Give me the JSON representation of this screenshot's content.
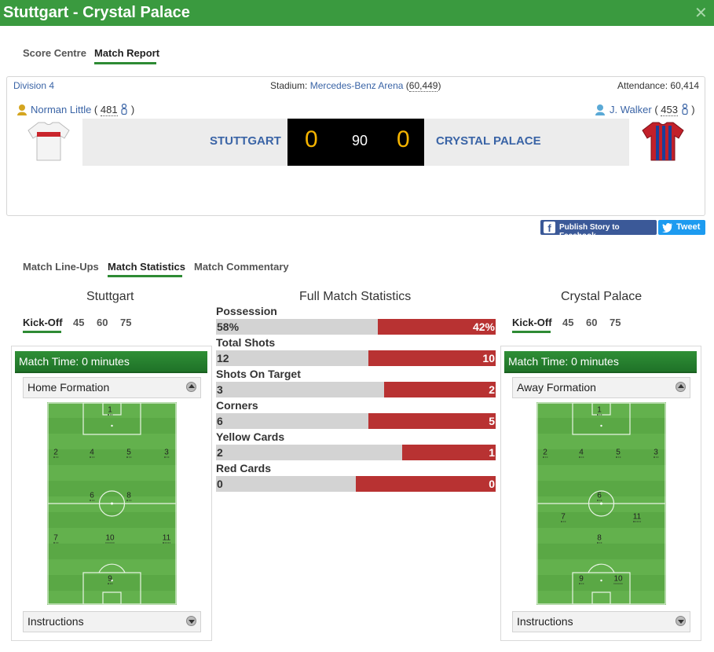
{
  "window": {
    "title": "Stuttgart - Crystal Palace",
    "close_glyph": "✕"
  },
  "top_tabs": [
    {
      "label": "Score Centre",
      "active": false
    },
    {
      "label": "Match Report",
      "active": true
    }
  ],
  "match": {
    "division": "Division 4",
    "stadium_label": "Stadium:",
    "stadium_name": "Mercedes-Benz Arena",
    "stadium_capacity": "60,449",
    "attendance_label": "Attendance:",
    "attendance": "60,414",
    "home": {
      "manager": "Norman Little",
      "manager_rating": "481",
      "name": "STUTTGART",
      "score": "0"
    },
    "away": {
      "manager": "J. Walker",
      "manager_rating": "453",
      "name": "CRYSTAL PALACE",
      "score": "0"
    },
    "minute": "90"
  },
  "share": {
    "facebook_label": "Publish Story to Facebook",
    "tweet_label": "Tweet"
  },
  "section_tabs": [
    {
      "label": "Match Line-Ups",
      "active": false
    },
    {
      "label": "Match Statistics",
      "active": true
    },
    {
      "label": "Match Commentary",
      "active": false
    }
  ],
  "home_panel": {
    "title": "Stuttgart",
    "time_tabs": [
      "Kick-Off",
      "45",
      "60",
      "75"
    ],
    "match_time": "Match Time: 0 minutes",
    "formation_label": "Home Formation",
    "instructions_label": "Instructions",
    "players": [
      "1",
      "2",
      "4",
      "5",
      "3",
      "6",
      "8",
      "7",
      "10",
      "11",
      "9"
    ]
  },
  "away_panel": {
    "title": "Crystal Palace",
    "time_tabs": [
      "Kick-Off",
      "45",
      "60",
      "75"
    ],
    "match_time": "Match Time: 0 minutes",
    "formation_label": "Away Formation",
    "instructions_label": "Instructions",
    "players": [
      "1",
      "2",
      "4",
      "5",
      "3",
      "6",
      "7",
      "11",
      "8",
      "9",
      "10"
    ]
  },
  "stats": {
    "title": "Full Match Statistics",
    "rows": [
      {
        "label": "Possession",
        "home": "58%",
        "away": "42%",
        "home_share": 0.58
      },
      {
        "label": "Total Shots",
        "home": "12",
        "away": "10",
        "home_share": 0.545
      },
      {
        "label": "Shots On Target",
        "home": "3",
        "away": "2",
        "home_share": 0.6
      },
      {
        "label": "Corners",
        "home": "6",
        "away": "5",
        "home_share": 0.545
      },
      {
        "label": "Yellow Cards",
        "home": "2",
        "away": "1",
        "home_share": 0.667
      },
      {
        "label": "Red Cards",
        "home": "0",
        "away": "0",
        "home_share": 0.5
      }
    ]
  },
  "colors": {
    "header_green": "#3a9a3f",
    "link_blue": "#3a64a6",
    "score_yellow": "#f5b400",
    "stat_red": "#b83232"
  }
}
